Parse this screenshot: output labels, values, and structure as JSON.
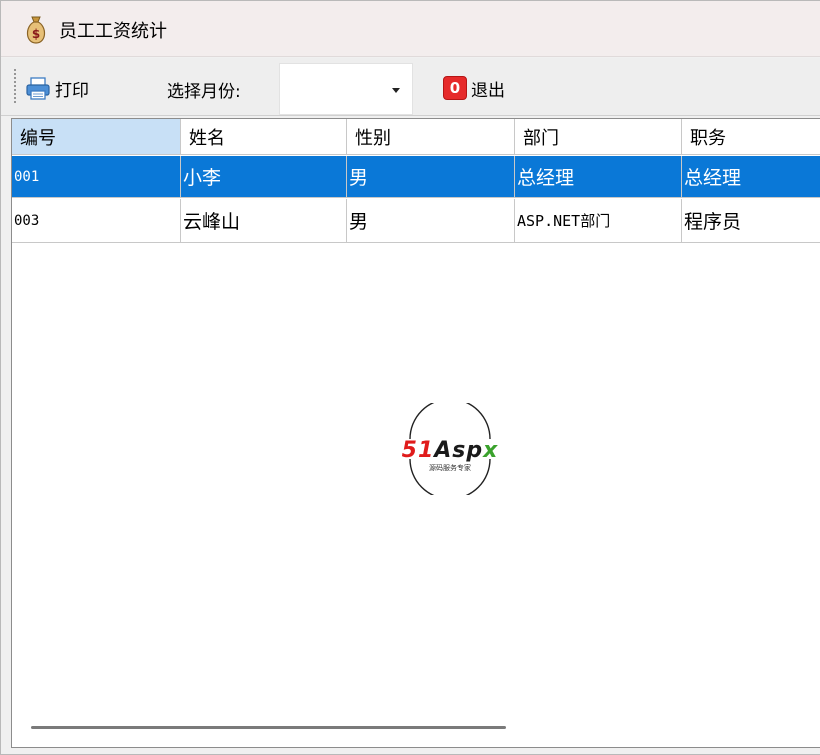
{
  "window": {
    "title": "员工工资统计"
  },
  "toolbar": {
    "print_label": "打印",
    "month_label": "选择月份:",
    "month_value": "",
    "exit_label": "退出"
  },
  "table": {
    "columns": [
      "编号",
      "姓名",
      "性别",
      "部门",
      "职务"
    ],
    "rows": [
      [
        "001",
        "小李",
        "男",
        "总经理",
        "总经理"
      ],
      [
        "003",
        "云峰山",
        "男",
        "ASP.NET部门",
        "程序员"
      ]
    ]
  },
  "watermark": {
    "brand": "51Aspx",
    "tagline": "源码服务专家"
  },
  "colors": {
    "selected_row": "#0a78d7",
    "header_selected": "#c8e0f6",
    "exit_icon": "#e62a2a"
  },
  "icons": {
    "title": "money-bag-icon",
    "print": "printer-icon",
    "dropdown": "chevron-down-icon",
    "exit": "exit-icon"
  }
}
